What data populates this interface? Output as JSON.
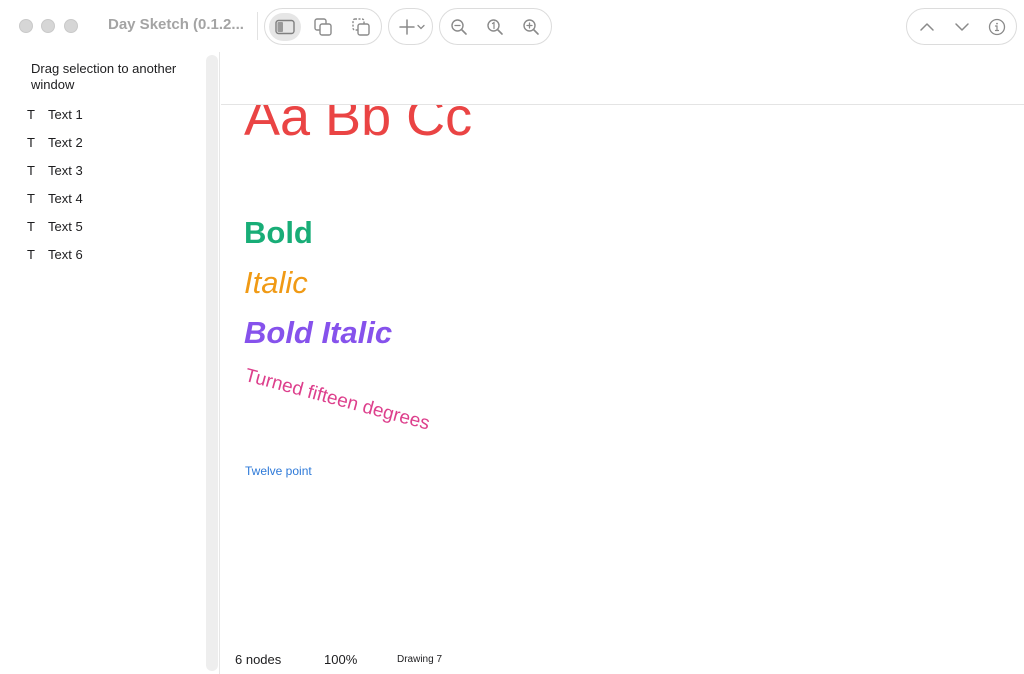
{
  "window": {
    "title": "Day Sketch (0.1.2..."
  },
  "toolbar": {
    "icons": [
      "sidebar-toggle-icon",
      "duplicate-icon",
      "copy-to-window-icon",
      "plus-icon",
      "chevron-down-icon",
      "zoom-out-icon",
      "zoom-actual-size-icon",
      "zoom-in-icon",
      "arrow-up-icon",
      "arrow-down-icon",
      "info-icon"
    ]
  },
  "sidebar": {
    "drag_hint": "Drag selection to another window",
    "items": [
      {
        "type_glyph": "T",
        "label": "Text 1"
      },
      {
        "type_glyph": "T",
        "label": "Text 2"
      },
      {
        "type_glyph": "T",
        "label": "Text 3"
      },
      {
        "type_glyph": "T",
        "label": "Text 4"
      },
      {
        "type_glyph": "T",
        "label": "Text 5"
      },
      {
        "type_glyph": "T",
        "label": "Text 6"
      }
    ]
  },
  "canvas": {
    "texts": [
      {
        "content": "Aa Bb Cc",
        "color": "#ea4444",
        "style": "regular"
      },
      {
        "content": "Bold",
        "color": "#18ad77",
        "style": "bold"
      },
      {
        "content": "Italic",
        "color": "#f09a15",
        "style": "italic"
      },
      {
        "content": "Bold Italic",
        "color": "#8652ec",
        "style": "bold-italic"
      },
      {
        "content": "Turned fifteen degrees",
        "color": "#dd3f8c",
        "style": "regular",
        "rotation_degrees": 15
      },
      {
        "content": "Twelve point",
        "color": "#2d79d8",
        "style": "regular"
      }
    ]
  },
  "status": {
    "nodes": "6 nodes",
    "zoom": "100%",
    "document": "Drawing 7"
  }
}
